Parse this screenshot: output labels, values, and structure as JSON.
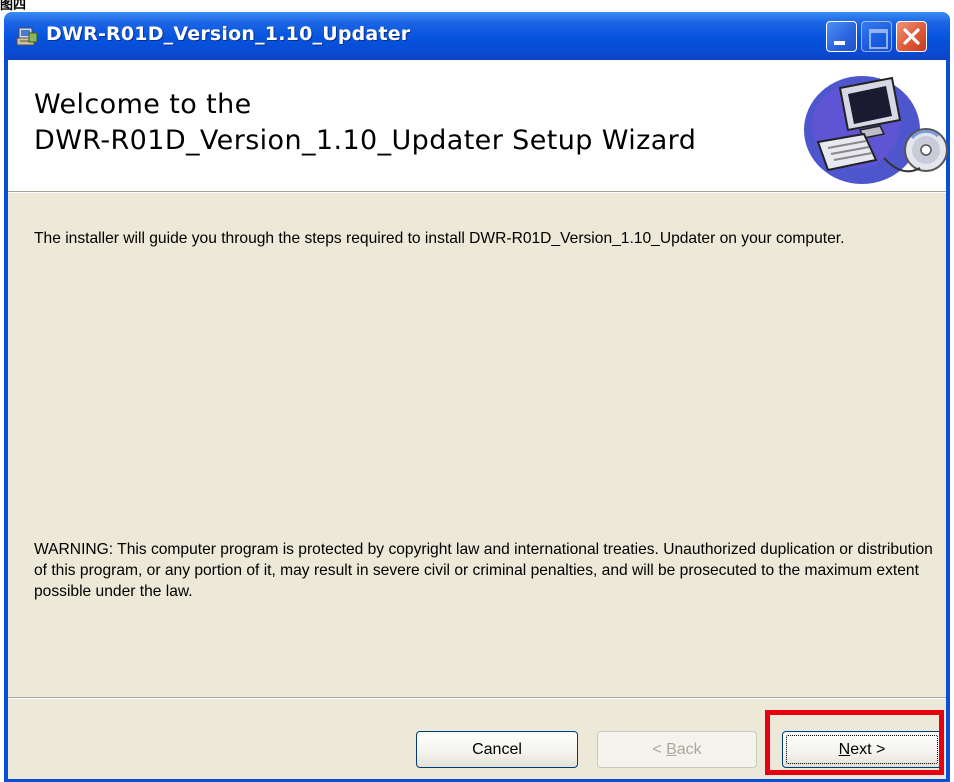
{
  "figure_label": "图四",
  "window": {
    "title": "DWR-R01D_Version_1.10_Updater",
    "title_icon": "installer-icon",
    "controls": [
      "minimize-icon",
      "maximize-icon",
      "close-icon"
    ]
  },
  "banner": {
    "heading_line1": "Welcome to the",
    "heading_line2": "DWR-R01D_Version_1.10_Updater Setup Wizard",
    "art_icon": "computer-cd-icon"
  },
  "body": {
    "intro": "The installer will guide you through the steps required to install DWR-R01D_Version_1.10_Updater on your computer.",
    "warning": "WARNING: This computer program is protected by copyright law and international treaties. Unauthorized duplication or distribution of this program, or any portion of it, may result in severe civil or criminal penalties, and will be prosecuted to the maximum extent possible under the law."
  },
  "buttons": {
    "cancel": "Cancel",
    "back_key": "B",
    "back_rest": "ack",
    "back_prefix": "< ",
    "next_key": "N",
    "next_rest": "ext >",
    "back_enabled": false
  },
  "colors": {
    "titlebar": "#0553de",
    "dialog_bg": "#ece9d8",
    "highlight": "#e60012"
  }
}
